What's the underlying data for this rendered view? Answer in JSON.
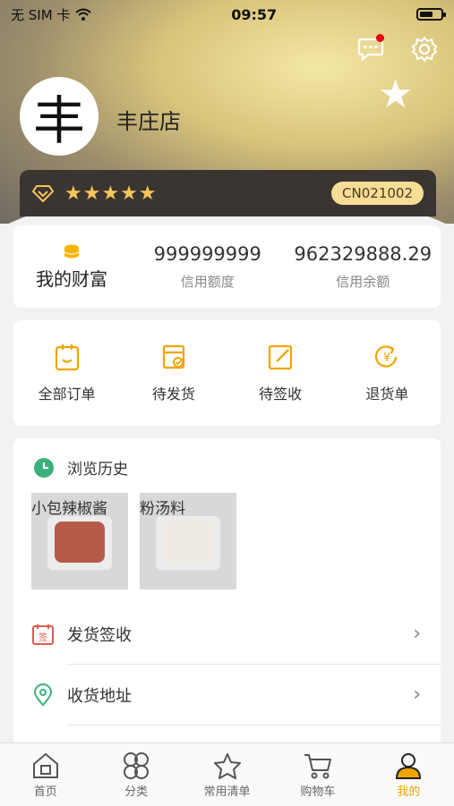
{
  "status_bar": {
    "carrier": "无 SIM 卡",
    "time": "09:57"
  },
  "profile": {
    "avatar_char": "丰",
    "store_name": "丰庄店",
    "rating_stars": "★★★★★",
    "code": "CN021002"
  },
  "wealth": {
    "title": "我的财富",
    "credit_limit": {
      "value": "999999999",
      "label": "信用额度"
    },
    "credit_balance": {
      "value": "962329888.29",
      "label": "信用余额"
    }
  },
  "orders": [
    {
      "label": "全部订单",
      "icon": "order-list-icon"
    },
    {
      "label": "待发货",
      "icon": "pending-ship-icon"
    },
    {
      "label": "待签收",
      "icon": "pending-sign-icon"
    },
    {
      "label": "退货单",
      "icon": "return-icon"
    }
  ],
  "history": {
    "title": "浏览历史",
    "products": [
      {
        "name": "小包辣椒酱",
        "color": "#b85a4a"
      },
      {
        "name": "粉汤料",
        "color": "#efebe4"
      }
    ]
  },
  "menu": [
    {
      "label": "发货签收",
      "icon": "sign-stamp-icon"
    },
    {
      "label": "收货地址",
      "icon": "location-icon"
    }
  ],
  "tabbar": [
    {
      "label": "首页",
      "icon": "home-icon"
    },
    {
      "label": "分类",
      "icon": "category-icon"
    },
    {
      "label": "常用清单",
      "icon": "star-list-icon"
    },
    {
      "label": "购物车",
      "icon": "cart-icon"
    },
    {
      "label": "我的",
      "icon": "profile-icon",
      "active": true
    }
  ],
  "colors": {
    "accent": "#f0a500",
    "badge_red": "#e60012",
    "vip_dark": "#3a3530",
    "gold": "#f7dd96"
  }
}
